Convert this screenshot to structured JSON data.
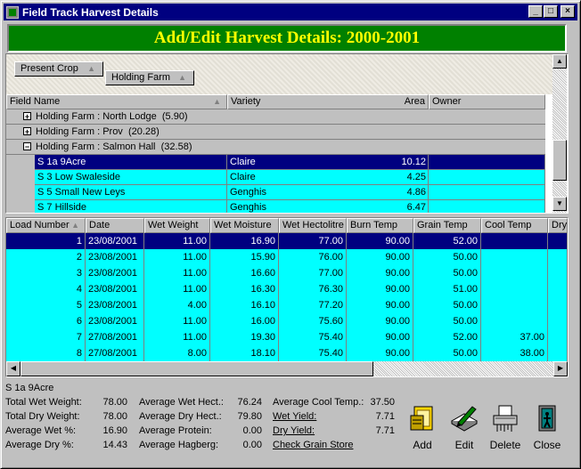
{
  "window": {
    "title": "Field Track Harvest Details"
  },
  "banner": {
    "title": "Add/Edit Harvest Details: 2000-2001"
  },
  "grouping": {
    "buttons": [
      "Present Crop",
      "Holding Farm"
    ]
  },
  "tree": {
    "columns": [
      "Field Name",
      "Variety",
      "Area",
      "Owner"
    ],
    "groups": [
      {
        "label": "Holding Farm : North Lodge",
        "count": "(5.90)",
        "expanded": false
      },
      {
        "label": "Holding Farm : Prov",
        "count": "(20.28)",
        "expanded": false
      },
      {
        "label": "Holding Farm : Salmon Hall",
        "count": "(32.58)",
        "expanded": true
      }
    ],
    "fields": [
      {
        "name": "S 1a 9Acre",
        "variety": "Claire",
        "area": "10.12",
        "owner": "",
        "selected": true
      },
      {
        "name": "S 3 Low Swaleside",
        "variety": "Claire",
        "area": "4.25",
        "owner": "",
        "selected": false
      },
      {
        "name": "S 5 Small New Leys",
        "variety": "Genghis",
        "area": "4.86",
        "owner": "",
        "selected": false
      },
      {
        "name": "S 7 Hillside",
        "variety": "Genghis",
        "area": "6.47",
        "owner": "",
        "selected": false
      }
    ]
  },
  "loads": {
    "columns": [
      "Load Number",
      "Date",
      "Wet Weight",
      "Wet Moisture",
      "Wet Hectolitre",
      "Burn Temp",
      "Grain Temp",
      "Cool Temp",
      "Dry"
    ],
    "rows": [
      [
        "1",
        "23/08/2001",
        "11.00",
        "16.90",
        "77.00",
        "90.00",
        "52.00",
        "",
        ""
      ],
      [
        "2",
        "23/08/2001",
        "11.00",
        "15.90",
        "76.00",
        "90.00",
        "50.00",
        "",
        ""
      ],
      [
        "3",
        "23/08/2001",
        "11.00",
        "16.60",
        "77.00",
        "90.00",
        "50.00",
        "",
        ""
      ],
      [
        "4",
        "23/08/2001",
        "11.00",
        "16.30",
        "76.30",
        "90.00",
        "51.00",
        "",
        ""
      ],
      [
        "5",
        "23/08/2001",
        "4.00",
        "16.10",
        "77.20",
        "90.00",
        "50.00",
        "",
        ""
      ],
      [
        "6",
        "23/08/2001",
        "11.00",
        "16.00",
        "75.60",
        "90.00",
        "50.00",
        "",
        ""
      ],
      [
        "7",
        "27/08/2001",
        "11.00",
        "19.30",
        "75.40",
        "90.00",
        "52.00",
        "37.00",
        ""
      ],
      [
        "8",
        "27/08/2001",
        "8.00",
        "18.10",
        "75.40",
        "90.00",
        "50.00",
        "38.00",
        ""
      ]
    ]
  },
  "summary": {
    "field_name": "S 1a 9Acre",
    "col1": [
      {
        "label": "Total Wet Weight:",
        "value": "78.00"
      },
      {
        "label": "Total Dry Weight:",
        "value": "78.00"
      },
      {
        "label": "Average Wet %:",
        "value": "16.90"
      },
      {
        "label": "Average Dry %:",
        "value": "14.43"
      }
    ],
    "col2": [
      {
        "label": "Average Wet Hect.:",
        "value": "76.24"
      },
      {
        "label": "Average Dry Hect.:",
        "value": "79.80"
      },
      {
        "label": "Average Protein:",
        "value": "0.00"
      },
      {
        "label": "Average Hagberg:",
        "value": "0.00"
      }
    ],
    "col3": [
      {
        "label": "Average Cool Temp.:",
        "value": "37.50"
      },
      {
        "label": "Wet Yield:",
        "value": "7.71"
      },
      {
        "label": "Dry Yield:",
        "value": "7.71"
      },
      {
        "label": "Check Grain Store",
        "value": ""
      }
    ]
  },
  "actions": {
    "add": "Add",
    "edit": "Edit",
    "delete": "Delete",
    "close": "Close"
  },
  "icons": {
    "app": "field-track-icon",
    "add": "add-record-icon",
    "edit": "edit-pen-icon",
    "delete": "shredder-icon",
    "close": "exit-door-icon"
  },
  "colors": {
    "titlebar": "#000080",
    "banner": "#008000",
    "banner_text": "#ffff00",
    "row": "#00ffff",
    "selected": "#000080"
  }
}
